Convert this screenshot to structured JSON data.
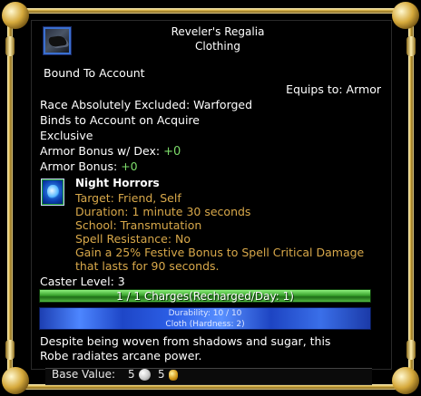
{
  "item": {
    "name": "Reveler's Regalia",
    "type": "Clothing",
    "bound": "Bound To Account",
    "equips_to": "Equips to: Armor",
    "race_excluded": "Race Absolutely Excluded: Warforged",
    "binds_on": "Binds to Account on Acquire",
    "exclusive": "Exclusive",
    "armor_bonus_dex_label": "Armor Bonus w/ Dex:",
    "armor_bonus_dex_value": "+0",
    "armor_bonus_label": "Armor Bonus:",
    "armor_bonus_value": "+0"
  },
  "spell": {
    "icon": "night-horrors-spell-icon",
    "name": "Night Horrors",
    "target": "Target: Friend, Self",
    "duration": "Duration: 1 minute 30 seconds",
    "school": "School: Transmutation",
    "resistance": "Spell Resistance: No",
    "desc_line1": "Gain a 25% Festive Bonus to Spell Critical Damage",
    "desc_line2": "that lasts for 90 seconds."
  },
  "caster_level": "Caster Level: 3",
  "charges": "1 / 1 Charges(Recharged/Day: 1)",
  "durability": {
    "line1": "Durability: 10 / 10",
    "line2": "Cloth (Hardness: 2)"
  },
  "description": {
    "line1": "Despite being woven from shadows and sugar, this",
    "line2": "Robe radiates arcane power."
  },
  "base_value": {
    "label": "Base Value:",
    "platinum": "5",
    "gold": "5"
  },
  "colors": {
    "frame_gold": "#d9b44a",
    "bonus_green": "#7ddc6a",
    "spell_text": "#d8a84a",
    "charges_bar": "#3aa52e",
    "durability_bar": "#2c5fe6"
  }
}
